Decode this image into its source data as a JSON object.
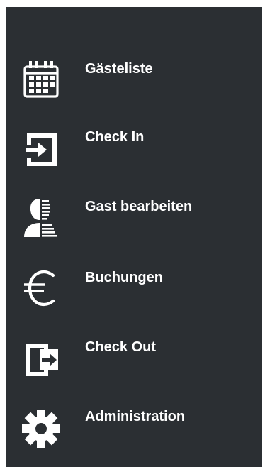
{
  "theme": {
    "panel_bg": "#2b2f33",
    "text_color": "#ffffff",
    "icon_color": "#ffffff"
  },
  "sidebar": {
    "items": [
      {
        "label": "Gästeliste",
        "icon": "calendar-grid-icon"
      },
      {
        "label": "Check In",
        "icon": "sign-in-icon"
      },
      {
        "label": "Gast bearbeiten",
        "icon": "user-edit-icon"
      },
      {
        "label": "Buchungen",
        "icon": "euro-icon"
      },
      {
        "label": "Check Out",
        "icon": "sign-out-icon"
      },
      {
        "label": "Administration",
        "icon": "gear-icon"
      }
    ]
  }
}
